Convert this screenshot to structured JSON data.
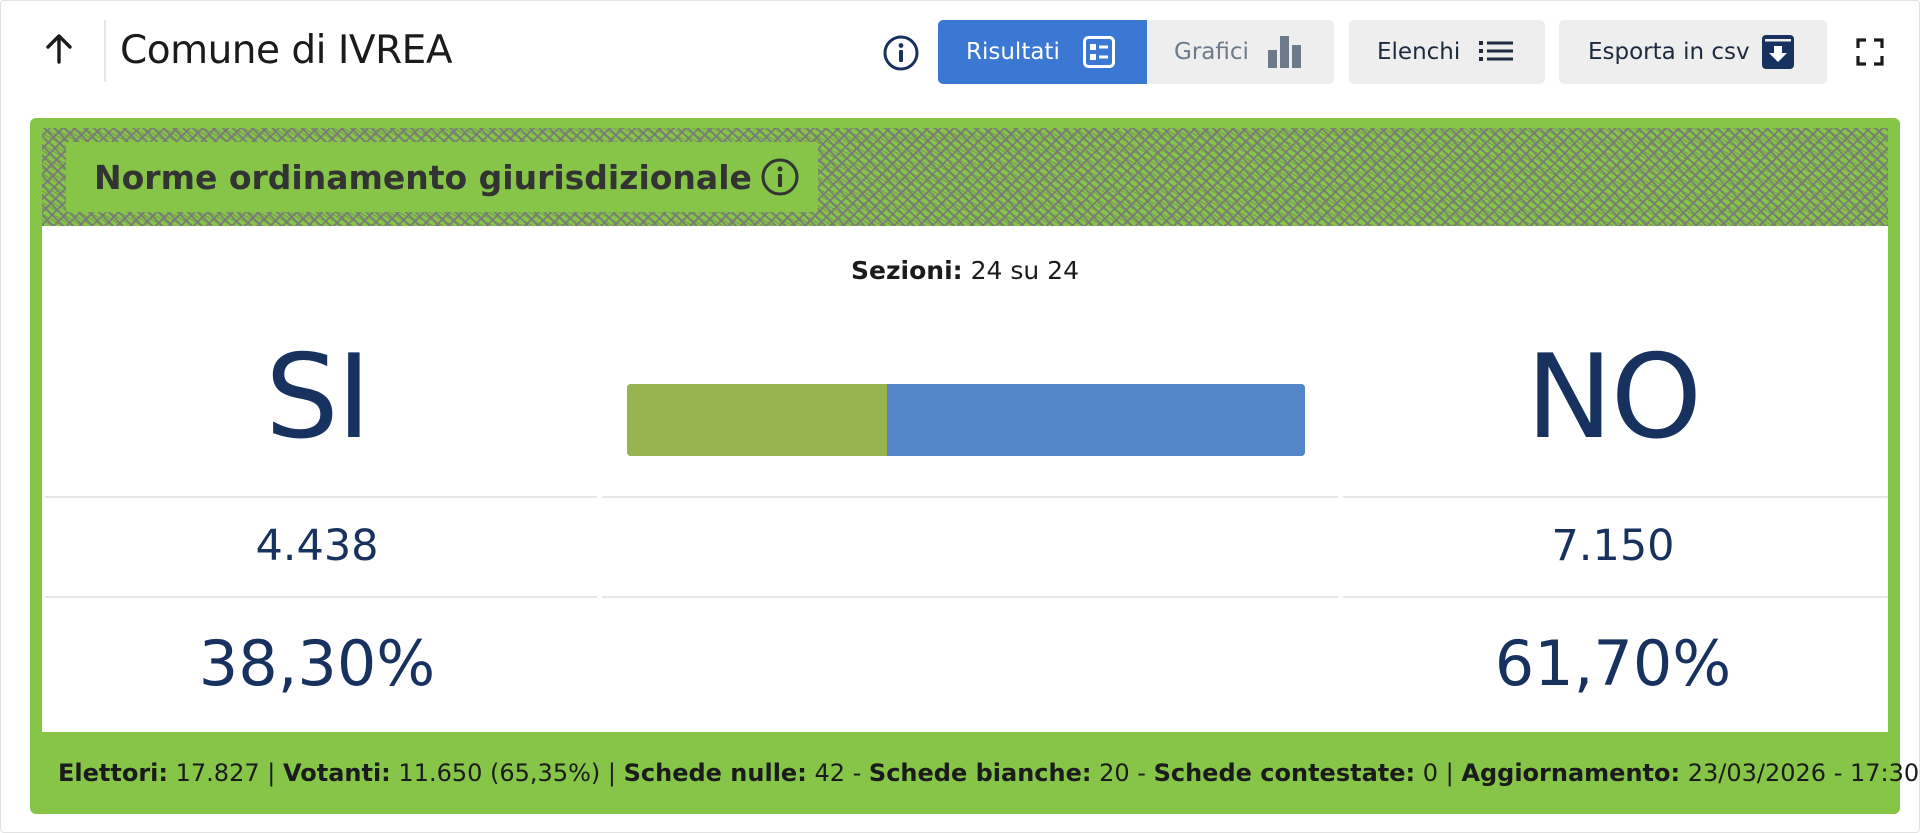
{
  "header": {
    "title": "Comune di IVREA",
    "tabs": [
      {
        "label": "Risultati",
        "active": true
      },
      {
        "label": "Grafici",
        "active": false
      }
    ],
    "elenchi_label": "Elenchi",
    "export_label": "Esporta in csv"
  },
  "referendum": {
    "title": "Norme ordinamento giurisdizionale",
    "sezioni_label": "Sezioni:",
    "sezioni_value": "24 su 24",
    "si": {
      "label": "SI",
      "votes": "4.438",
      "percent": "38,30%",
      "share": 0.383
    },
    "no": {
      "label": "NO",
      "votes": "7.150",
      "percent": "61,70%",
      "share": 0.617
    }
  },
  "footer": {
    "elettori_label": "Elettori:",
    "elettori_value": "17.827",
    "votanti_label": "Votanti:",
    "votanti_value": "11.650 (65,35%)",
    "nulle_label": "Schede nulle:",
    "nulle_value": "42",
    "bianche_label": "Schede bianche:",
    "bianche_value": "20",
    "contestate_label": "Schede contestate:",
    "contestate_value": "0",
    "aggiornamento_label": "Aggiornamento:",
    "aggiornamento_value": "23/03/2026 - 17:30"
  },
  "colors": {
    "accent_blue": "#3a78d3",
    "card_green": "#86c548",
    "si_bar": "#97b450",
    "no_bar": "#5286c9",
    "text_navy": "#17325e"
  },
  "icons": [
    "arrow-up-icon",
    "info-icon",
    "results-list-icon",
    "bar-chart-icon",
    "list-icon",
    "download-box-icon",
    "fullscreen-icon"
  ]
}
